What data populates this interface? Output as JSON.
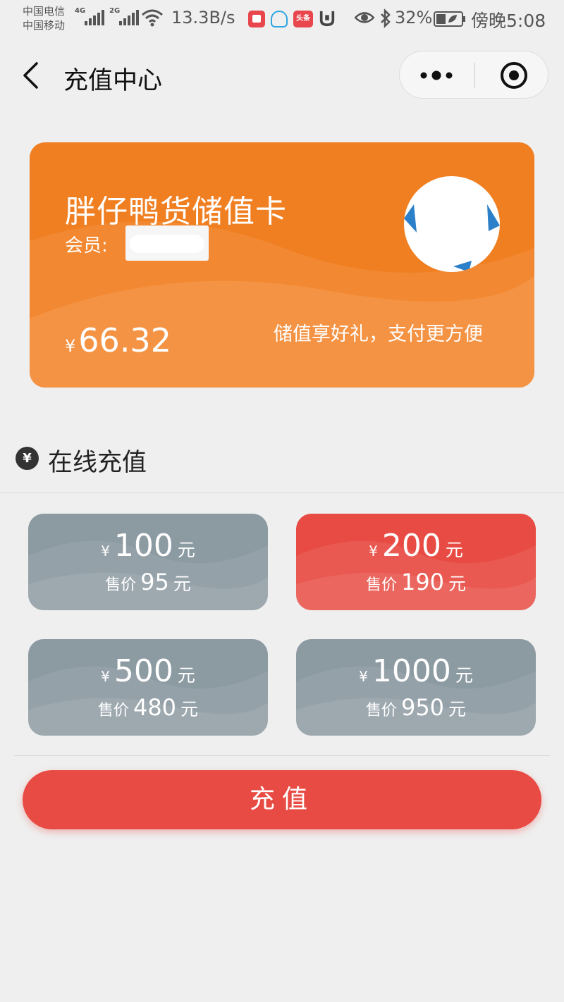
{
  "status_bar": {
    "carrier1": "中国电信",
    "carrier2": "中国移动",
    "network1": "4G",
    "network2": "2G",
    "net_speed": "13.3B/s",
    "toutiao_badge": "头条",
    "battery_percent": "32%",
    "time": "傍晚5:08"
  },
  "header": {
    "title": "充值中心"
  },
  "card": {
    "name": "胖仔鸭货储值卡",
    "member_label": "会员:",
    "currency": "¥",
    "balance": "66.32",
    "slogan": "储值享好礼，支付更方便",
    "color": "#f07f22"
  },
  "section": {
    "title": "在线充值",
    "icon_text": "¥"
  },
  "options": [
    {
      "currency": "¥",
      "amount": "100",
      "unit": "元",
      "price_label": "售价",
      "price": "95",
      "price_unit": "元",
      "selected": false
    },
    {
      "currency": "¥",
      "amount": "200",
      "unit": "元",
      "price_label": "售价",
      "price": "190",
      "price_unit": "元",
      "selected": true
    },
    {
      "currency": "¥",
      "amount": "500",
      "unit": "元",
      "price_label": "售价",
      "price": "480",
      "price_unit": "元",
      "selected": false
    },
    {
      "currency": "¥",
      "amount": "1000",
      "unit": "元",
      "price_label": "售价",
      "price": "950",
      "price_unit": "元",
      "selected": false
    }
  ],
  "colors": {
    "accent": "#e84b43",
    "option_default": "#8c9aa2"
  },
  "submit": {
    "label": "充值"
  }
}
